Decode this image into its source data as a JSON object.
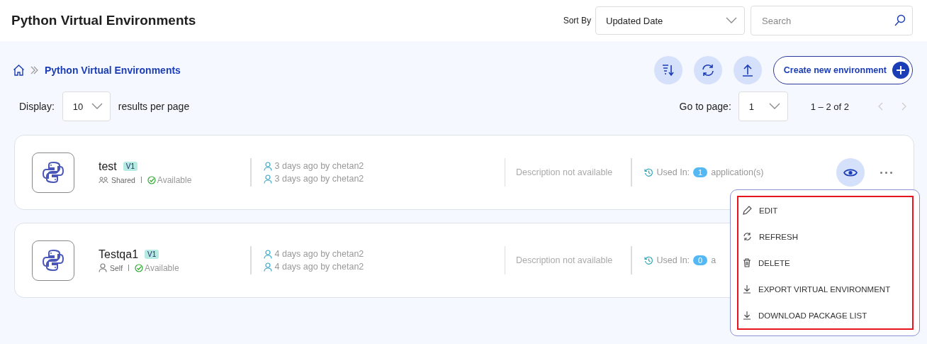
{
  "header": {
    "title": "Python Virtual Environments",
    "sort_label": "Sort By",
    "sort_value": "Updated Date",
    "search": {
      "placeholder": "Search"
    }
  },
  "breadcrumb": [
    "Python Virtual Environments"
  ],
  "create_button": "Create new environment",
  "display": {
    "label": "Display:",
    "value": "10",
    "suffix": "results per page"
  },
  "pager": {
    "label": "Go to page:",
    "value": "1",
    "range": "1 – 2 of 2"
  },
  "environments": [
    {
      "name": "test",
      "version": "V1",
      "scope": "Shared",
      "kind": "shared",
      "status": "Available",
      "created": "3 days ago by chetan2",
      "updated": "3 days ago by chetan2",
      "description": "Description not available",
      "used_label": "Used In:",
      "used_count": "1",
      "used_suffix": "application(s)"
    },
    {
      "name": "Testqa1",
      "version": "V1",
      "scope": "Self",
      "kind": "self",
      "status": "Available",
      "created": "4 days ago by chetan2",
      "updated": "4 days ago by chetan2",
      "description": "Description not available",
      "used_label": "Used In:",
      "used_count": "0",
      "used_suffix": "a"
    }
  ],
  "menu": {
    "highlighted": true,
    "items": [
      {
        "kind": "edit",
        "label": "EDIT"
      },
      {
        "kind": "refresh",
        "label": "REFRESH"
      },
      {
        "kind": "delete",
        "label": "DELETE"
      },
      {
        "kind": "download",
        "label": "EXPORT VIRTUAL ENVIRONMENT"
      },
      {
        "kind": "download",
        "label": "DOWNLOAD PACKAGE LIST"
      }
    ]
  }
}
